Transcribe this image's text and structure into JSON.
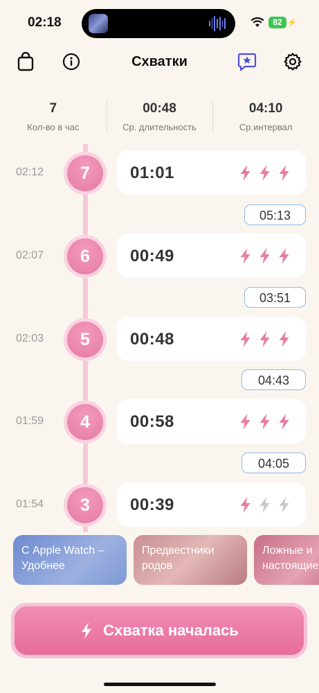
{
  "status_bar": {
    "time": "02:18",
    "battery": "82"
  },
  "header": {
    "title": "Схватки"
  },
  "colors": {
    "accent": "#E97CA5",
    "bolt_active": "#E97CA5",
    "bolt_inactive": "#C8C8C8",
    "interval_border": "#8BBBE8",
    "background": "#FBF5EF"
  },
  "stats": [
    {
      "value": "7",
      "label": "Кол-во в час"
    },
    {
      "value": "00:48",
      "label": "Ср. длительность"
    },
    {
      "value": "04:10",
      "label": "Ср.интервал"
    }
  ],
  "contractions": [
    {
      "time": "02:12",
      "number": "7",
      "duration": "01:01",
      "intensity": 3
    },
    {
      "time": "02:07",
      "number": "6",
      "duration": "00:49",
      "intensity": 3
    },
    {
      "time": "02:03",
      "number": "5",
      "duration": "00:48",
      "intensity": 3
    },
    {
      "time": "01:59",
      "number": "4",
      "duration": "00:58",
      "intensity": 3
    },
    {
      "time": "01:54",
      "number": "3",
      "duration": "00:39",
      "intensity": 1
    }
  ],
  "intervals": [
    "05:13",
    "03:51",
    "04:43",
    "04:05"
  ],
  "promos": [
    {
      "text": "С Apple Watch – Удобнее"
    },
    {
      "text": "Предвестники родов"
    },
    {
      "text": "Ложные и настоящие"
    }
  ],
  "start_button": {
    "label": "Схватка началась"
  }
}
